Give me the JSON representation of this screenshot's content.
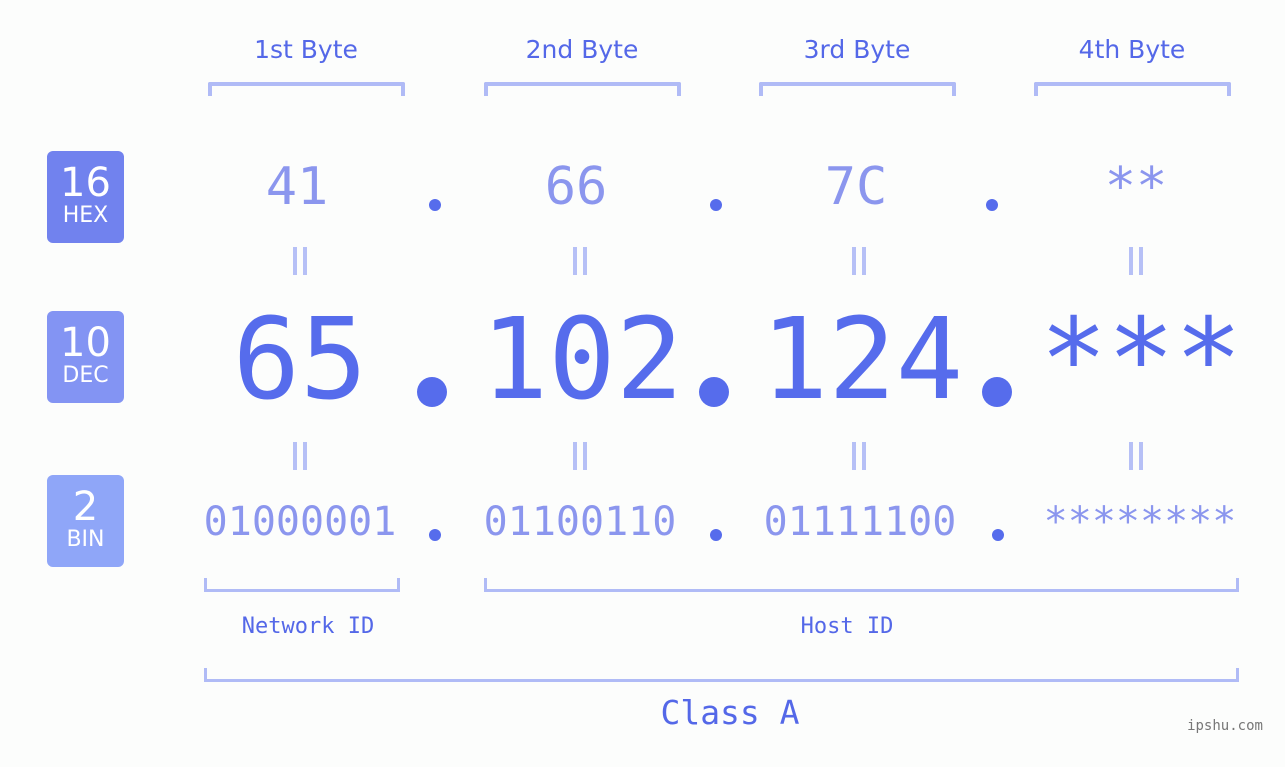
{
  "byte_headers": [
    "1st Byte",
    "2nd Byte",
    "3rd Byte",
    "4th Byte"
  ],
  "badges": {
    "hex": {
      "number": "16",
      "label": "HEX",
      "color": "#7182ee"
    },
    "dec": {
      "number": "10",
      "label": "DEC",
      "color": "#8394f3"
    },
    "bin": {
      "number": "2",
      "label": "BIN",
      "color": "#8fa6f8"
    }
  },
  "hex_values": [
    "41",
    "66",
    "7C",
    "**"
  ],
  "dec_values": [
    "65",
    "102",
    "124",
    "***"
  ],
  "bin_values": [
    "01000001",
    "01100110",
    "01111100",
    "********"
  ],
  "id_labels": {
    "network": "Network ID",
    "host": "Host ID"
  },
  "class_label": "Class A",
  "watermark": "ipshu.com",
  "colors": {
    "accent": "#566cec",
    "light_text": "#8b96ee",
    "bracket": "#b0bbf6"
  }
}
